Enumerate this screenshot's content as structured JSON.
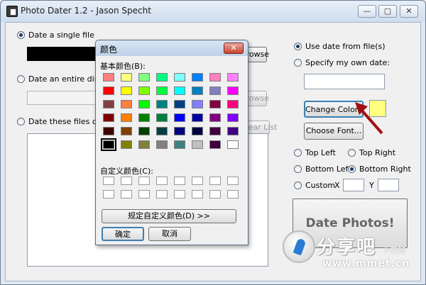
{
  "window": {
    "title": "Photo Dater 1.2 - Jason Specht",
    "min_glyph": "—",
    "max_glyph": "▢",
    "close_glyph": "✕"
  },
  "left": {
    "single_file_label": "Date a single file",
    "single_browse_label": "Browse",
    "directory_label": "Date an entire directo",
    "directory_browse_label": "Browse",
    "files_only_label": "Date these files only",
    "clear_list_label": "Clear List"
  },
  "right": {
    "use_date_label": "Use date from file(s)",
    "specify_date_label": "Specify my own date:",
    "change_color_label": "Change Color...",
    "change_font_label": "Choose Font...",
    "top_left_label": "Top Left",
    "top_right_label": "Top Right",
    "bottom_left_label": "Bottom Left",
    "bottom_right_label": "Bottom Right",
    "custom_label": "Custom",
    "x_label": "X",
    "y_label": "Y",
    "date_photos_label": "Date Photos!",
    "selected_color": "#ffff80"
  },
  "color_dialog": {
    "title": "颜色",
    "close_glyph": "✕",
    "basic_colors_label": "基本颜色(B):",
    "custom_colors_label": "自定义颜色(C):",
    "define_custom_label": "规定自定义颜色(D) >>",
    "ok_label": "确定",
    "cancel_label": "取消",
    "basic_colors": [
      [
        "#ff8080",
        "#ffff80",
        "#80ff80",
        "#00ff80",
        "#80ffff",
        "#0080ff",
        "#ff80c0",
        "#ff80ff"
      ],
      [
        "#ff0000",
        "#ffff00",
        "#80ff00",
        "#00ff40",
        "#00ffff",
        "#0080c0",
        "#8080c0",
        "#ff00ff"
      ],
      [
        "#804040",
        "#ff8040",
        "#00ff00",
        "#008080",
        "#004080",
        "#8080ff",
        "#800040",
        "#ff0080"
      ],
      [
        "#800000",
        "#ff8000",
        "#008000",
        "#008040",
        "#0000ff",
        "#0000a0",
        "#800080",
        "#8000ff"
      ],
      [
        "#400000",
        "#804000",
        "#004000",
        "#004040",
        "#000080",
        "#000040",
        "#400040",
        "#400080"
      ],
      [
        "#000000",
        "#808000",
        "#808040",
        "#808080",
        "#408080",
        "#c0c0c0",
        "#400040",
        "#ffffff"
      ]
    ]
  },
  "watermark": {
    "brand": "分享吧",
    "sub": "下载站",
    "url": "www.mmet.cn"
  }
}
